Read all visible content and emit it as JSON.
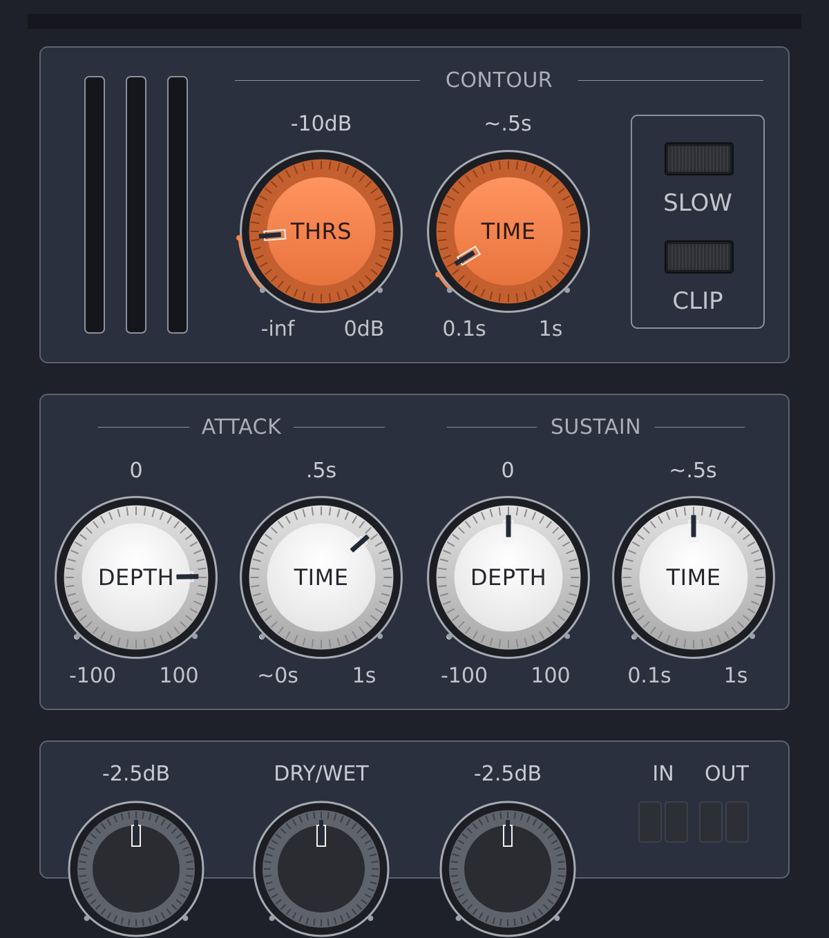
{
  "contour": {
    "title": "CONTOUR",
    "threshold": {
      "label": "THRS",
      "value": "-10dB",
      "min": "-inf",
      "max": "0dB",
      "position": 0.15
    },
    "time": {
      "label": "TIME",
      "value": "~.5s",
      "min": "0.1s",
      "max": "1s",
      "position": 0.05
    },
    "slow_label": "SLOW",
    "clip_label": "CLIP"
  },
  "attack": {
    "title": "ATTACK",
    "depth": {
      "label": "DEPTH",
      "value": "0",
      "min": "-100",
      "max": "100",
      "position": 0.83
    },
    "time": {
      "label": "TIME",
      "value": ".5s",
      "min": "~0s",
      "max": "1s",
      "position": 0.68
    }
  },
  "sustain": {
    "title": "SUSTAIN",
    "depth": {
      "label": "DEPTH",
      "value": "0",
      "min": "-100",
      "max": "100",
      "position": 0.5
    },
    "time": {
      "label": "TIME",
      "value": "~.5s",
      "min": "0.1s",
      "max": "1s",
      "position": 0.5
    }
  },
  "output": {
    "input_gain_value": "-2.5dB",
    "dry_wet_label": "DRY/WET",
    "output_gain_value": "-2.5dB",
    "in_label": "IN",
    "out_label": "OUT"
  },
  "colors": {
    "background": "#1e2129",
    "panel": "#2a303d",
    "accent": "#f5854d",
    "knob_white": "#ffffff"
  }
}
